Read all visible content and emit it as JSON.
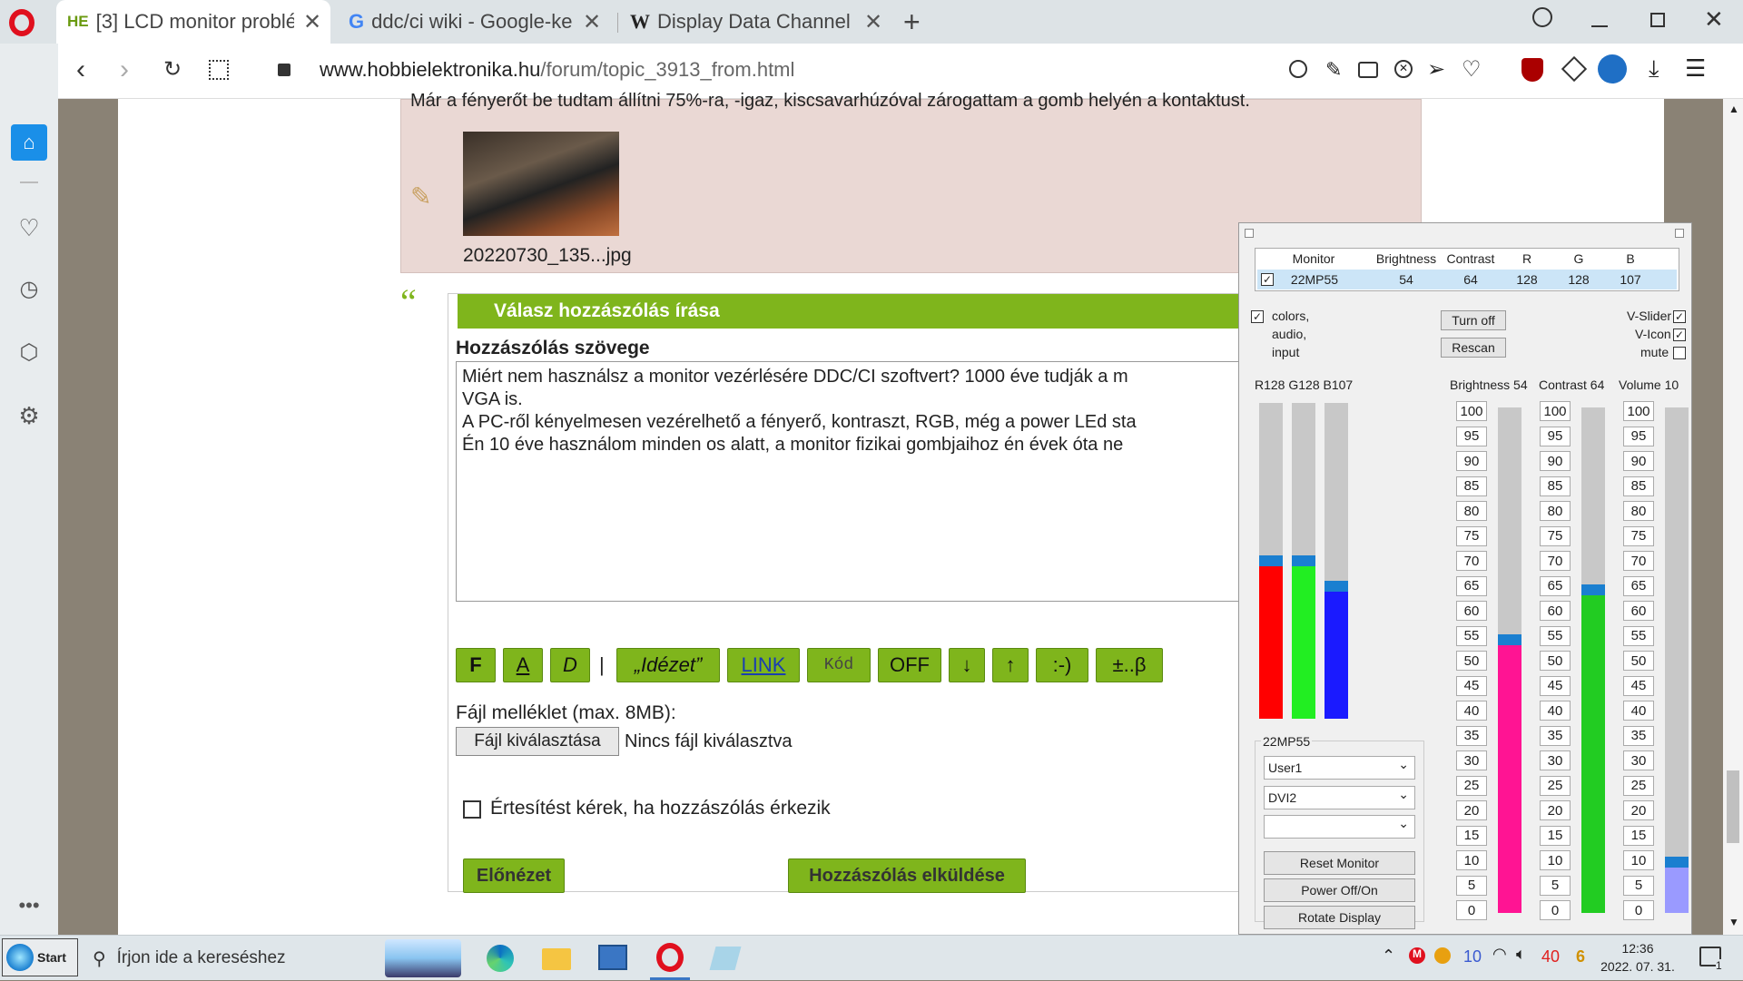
{
  "browser": {
    "tabs": [
      {
        "favicon": "HE",
        "title": "[3] LCD monitor problé",
        "active": true
      },
      {
        "favicon": "G",
        "title": "ddc/ci wiki - Google-ke",
        "active": false
      },
      {
        "favicon": "W",
        "title": "Display Data Channel -",
        "active": false
      }
    ],
    "url_domain": "www.hobbielektronika.hu",
    "url_path": "/forum/topic_3913_from.html"
  },
  "post": {
    "top_text": "Már a fényerőt be tudtam állítni 75%-ra, -igaz, kiscsavarhúzóval zárogattam a gomb helyén a kontaktust.",
    "attachment_name": "20220730_135...jpg"
  },
  "reply": {
    "header": "Válasz hozzászólás írása",
    "textarea_label": "Hozzászólás szövege",
    "text_lines": [
      "Miért nem használsz a monitor vezérlésére DDC/CI szoftvert? 1000 éve tudják a m",
      "VGA is.",
      "A PC-ről kényelmesen vezérelhető a fényerő, kontraszt, RGB, még a power LEd sta",
      "Én 10 éve használom minden os alatt, a monitor fizikai gombjaihoz én évek óta ne"
    ],
    "toolbar": [
      "F",
      "A",
      "D",
      "„Idézet”",
      "LINK",
      "Kód",
      "OFF",
      "↓",
      "↑",
      ":-)",
      "±..β"
    ],
    "toolbar_sep": "|",
    "file_label": "Fájl melléklet (max. 8MB):",
    "file_button": "Fájl kiválasztása",
    "file_status": "Nincs fájl kiválasztva",
    "notify_label": "Értesítést kérek, ha hozzászólás érkezik",
    "preview_button": "Előnézet",
    "submit_button": "Hozzászólás elküldése"
  },
  "monitor_tool": {
    "table_headers": [
      "Monitor",
      "Brightness",
      "Contrast",
      "R",
      "G",
      "B"
    ],
    "row": {
      "monitor": "22MP55",
      "brightness": "54",
      "contrast": "64",
      "r": "128",
      "g": "128",
      "b": "107"
    },
    "opt_colors": "colors,",
    "opt_audio": "audio,",
    "opt_input": "input",
    "turn_off": "Turn off",
    "rescan": "Rescan",
    "v_slider": "V-Slider",
    "v_icon": "V-Icon",
    "mute": "mute",
    "rgb_label": "R128 G128 B107",
    "brightness_label": "Brightness 54",
    "contrast_label": "Contrast 64",
    "volume_label": "Volume 10",
    "group_label": "22MP55",
    "preset_select": "User1",
    "input_select": "DVI2",
    "reset_button": "Reset Monitor",
    "power_button": "Power Off/On",
    "rotate_button": "Rotate Display",
    "ticks": [
      "100",
      "95",
      "90",
      "85",
      "80",
      "75",
      "70",
      "65",
      "60",
      "55",
      "50",
      "45",
      "40",
      "35",
      "30",
      "25",
      "20",
      "15",
      "10",
      "5",
      "0"
    ],
    "levels": {
      "r": 0.5,
      "g": 0.5,
      "b": 0.42,
      "brightness": 54,
      "contrast": 64,
      "volume": 10
    },
    "colors": {
      "r": "#ff0000",
      "g": "#22ee22",
      "b": "#1a1aff",
      "brightness": "#ff1493",
      "contrast": "#22cc22",
      "volume": "#9a9aff"
    }
  },
  "taskbar": {
    "start": "Start",
    "search": "Írjon ide a kereséshez",
    "tray_num1": "10",
    "tray_num2": "40",
    "tray_num3": "6",
    "time": "12:36",
    "date": "2022. 07. 31.",
    "notif": "1"
  },
  "colors": {
    "accent": "#7fb51c",
    "opera_red": "#e0101e"
  }
}
